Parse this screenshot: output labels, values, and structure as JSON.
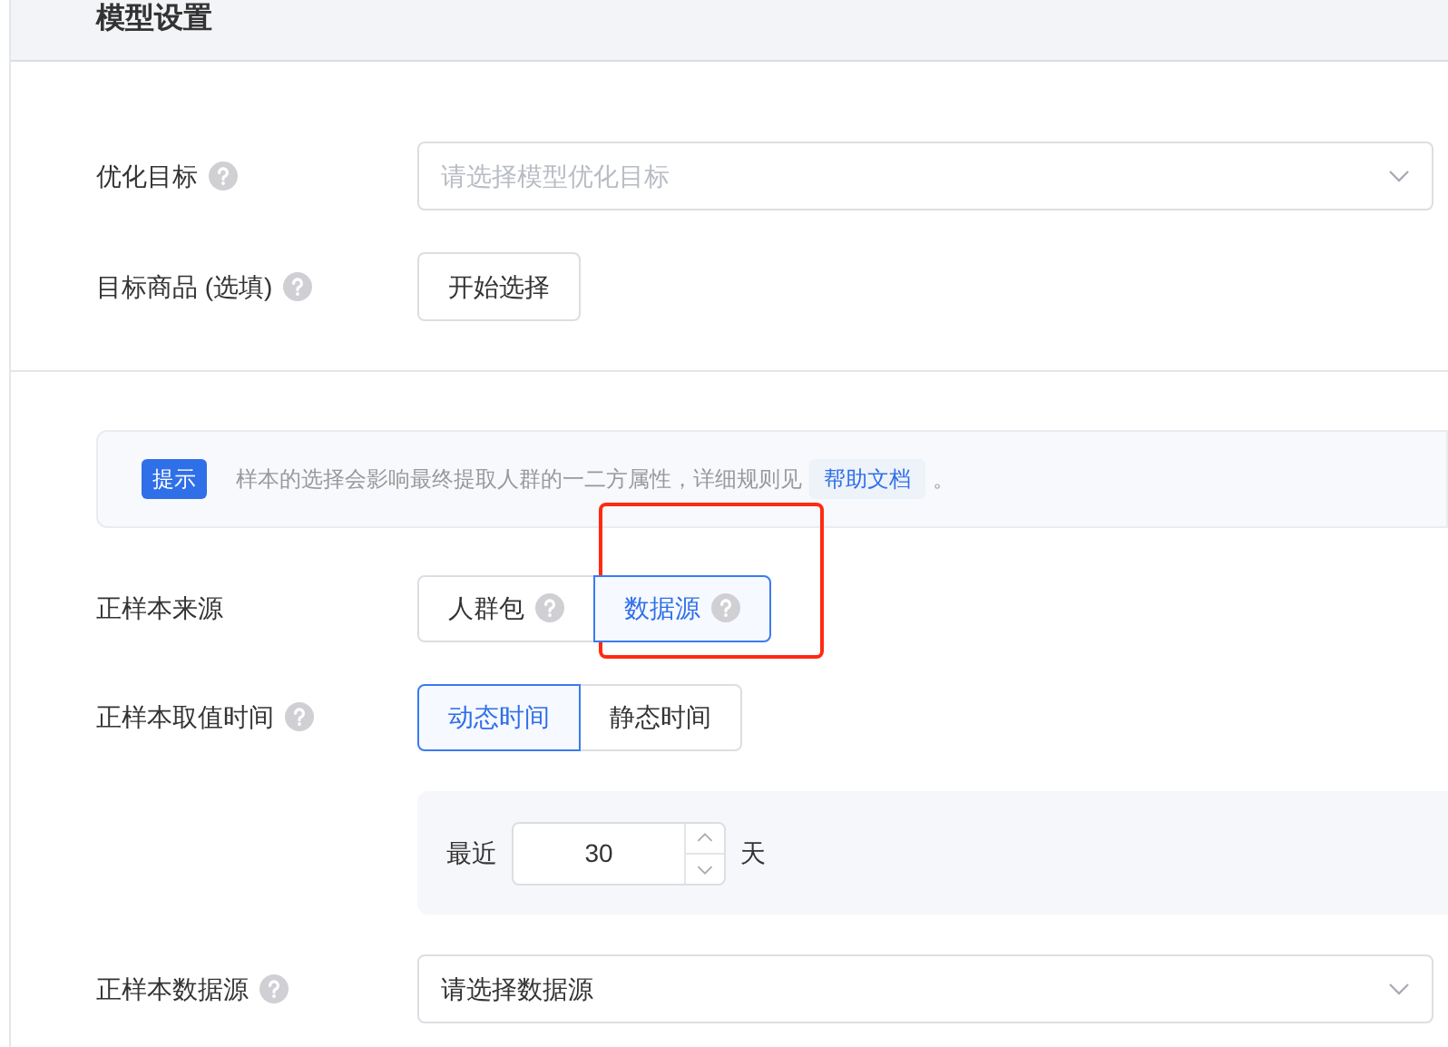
{
  "section": {
    "title": "模型设置"
  },
  "fields": [
    {
      "kind": "select",
      "label": "优化目标",
      "help": true,
      "placeholder": "请选择模型优化目标",
      "filled": false
    },
    {
      "kind": "button",
      "label": "目标商品 (选填)",
      "help": true,
      "button": "开始选择"
    }
  ],
  "tip": {
    "badge": "提示",
    "text": "样本的选择会影响最终提取人群的一二方属性，详细规则见",
    "link": "帮助文档",
    "suffix": "。"
  },
  "sample_fields": [
    {
      "kind": "segmented",
      "label": "正样本来源",
      "help": false,
      "options": [
        {
          "label": "人群包",
          "help": true,
          "selected": false
        },
        {
          "label": "数据源",
          "help": true,
          "selected": true
        }
      ]
    },
    {
      "kind": "segmented",
      "label": "正样本取值时间",
      "help": true,
      "options": [
        {
          "label": "动态时间",
          "help": false,
          "selected": true
        },
        {
          "label": "静态时间",
          "help": false,
          "selected": false
        }
      ]
    },
    {
      "kind": "range",
      "prefix": "最近",
      "value": "30",
      "unit": "天"
    },
    {
      "kind": "select",
      "label": "正样本数据源",
      "help": true,
      "placeholder": "请选择数据源",
      "filled": true
    }
  ],
  "annotations": [
    {
      "kind": "rectangle"
    }
  ]
}
